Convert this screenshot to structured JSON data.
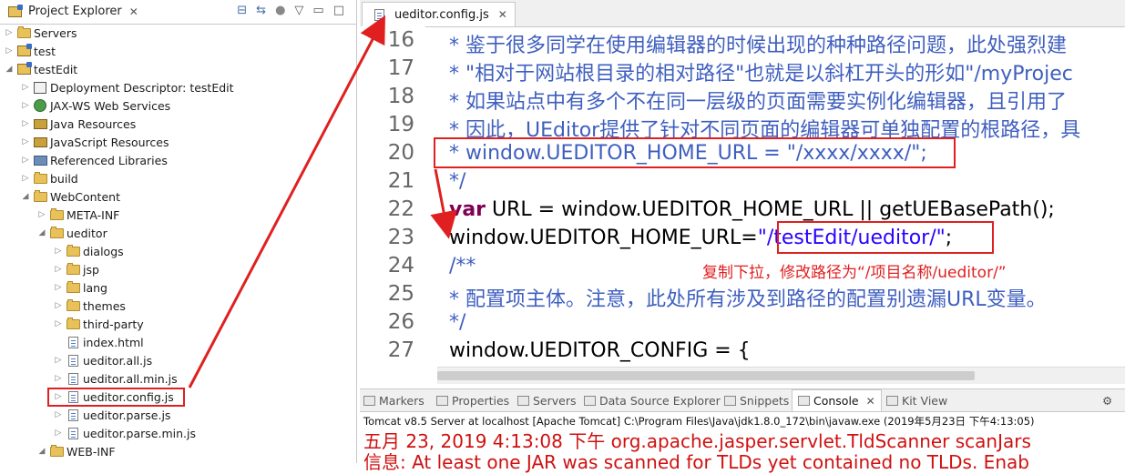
{
  "explorer": {
    "title": "Project Explorer",
    "close": "✕",
    "items": [
      {
        "label": "Servers",
        "icon": "servers-folder-icon"
      },
      {
        "label": "test",
        "icon": "project-icon"
      },
      {
        "label": "testEdit",
        "icon": "project-icon"
      },
      {
        "label": "Deployment Descriptor: testEdit",
        "icon": "deployment-descriptor-icon"
      },
      {
        "label": "JAX-WS Web Services",
        "icon": "web-services-icon"
      },
      {
        "label": "Java Resources",
        "icon": "java-resources-icon"
      },
      {
        "label": "JavaScript Resources",
        "icon": "javascript-resources-icon"
      },
      {
        "label": "Referenced Libraries",
        "icon": "library-icon"
      },
      {
        "label": "build",
        "icon": "folder-icon"
      },
      {
        "label": "WebContent",
        "icon": "folder-icon"
      },
      {
        "label": "META-INF",
        "icon": "folder-icon"
      },
      {
        "label": "ueditor",
        "icon": "folder-icon"
      },
      {
        "label": "dialogs",
        "icon": "folder-icon"
      },
      {
        "label": "jsp",
        "icon": "folder-icon"
      },
      {
        "label": "lang",
        "icon": "folder-icon"
      },
      {
        "label": "themes",
        "icon": "folder-icon"
      },
      {
        "label": "third-party",
        "icon": "folder-icon"
      },
      {
        "label": "index.html",
        "icon": "html-file-icon"
      },
      {
        "label": "ueditor.all.js",
        "icon": "js-file-icon"
      },
      {
        "label": "ueditor.all.min.js",
        "icon": "js-file-icon"
      },
      {
        "label": "ueditor.config.js",
        "icon": "js-file-icon"
      },
      {
        "label": "ueditor.parse.js",
        "icon": "js-file-icon"
      },
      {
        "label": "ueditor.parse.min.js",
        "icon": "js-file-icon"
      },
      {
        "label": "WEB-INF",
        "icon": "folder-icon"
      }
    ]
  },
  "editor": {
    "tab_label": "ueditor.config.js",
    "close": "✕",
    "line_numbers": [
      "16",
      "17",
      "18",
      "19",
      "20",
      "21",
      "22",
      "23",
      "24",
      "25",
      "26",
      "27"
    ],
    "lines": [
      {
        "text": " * 鉴于很多同学在使用编辑器的时候出现的种种路径问题，此处强烈建"
      },
      {
        "text": " * \"相对于网站根目录的相对路径\"也就是以斜杠开头的形如\"/myProjec"
      },
      {
        "text": " * 如果站点中有多个不在同一层级的页面需要实例化编辑器，且引用了"
      },
      {
        "text": " * 因此，UEditor提供了针对不同页面的编辑器可单独配置的根路径，具"
      },
      {
        "text": " * window.UEDITOR_HOME_URL = \"/xxxx/xxxx/\";"
      },
      {
        "text": " */"
      },
      {
        "kw": "var",
        "text": " URL = window.UEDITOR_HOME_URL || getUEBasePath();"
      },
      {
        "text": "window.UEDITOR_HOME_URL=",
        "str": "\"/testEdit/ueditor/\"",
        "tail": ";"
      },
      {
        "text": "/**"
      },
      {
        "text": " * 配置项主体。注意，此处所有涉及到路径的配置别遗漏URL变量。"
      },
      {
        "text": " */"
      },
      {
        "text": "window.UEDITOR_CONFIG = {"
      }
    ],
    "annotation": "复制下拉，修改路径为“/项目名称/ueditor/”"
  },
  "console": {
    "tabs": [
      "Markers",
      "Properties",
      "Servers",
      "Data Source Explorer",
      "Snippets",
      "Console",
      "Kit View"
    ],
    "active_tab": "Console",
    "title": "Tomcat v8.5 Server at localhost [Apache Tomcat] C:\\Program Files\\Java\\jdk1.8.0_172\\bin\\javaw.exe (2019年5月23日 下午4:13:05)",
    "log": [
      "五月 23, 2019 4:13:08 下午 org.apache.jasper.servlet.TldScanner scanJars",
      "信息: At least one JAR was scanned for TLDs yet contained no TLDs. Enab"
    ]
  },
  "colors": {
    "highlight": "#e02020",
    "comment": "#3f5fbf",
    "keyword": "#7f0055",
    "string": "#2a00ff",
    "console_error": "#d01010"
  }
}
